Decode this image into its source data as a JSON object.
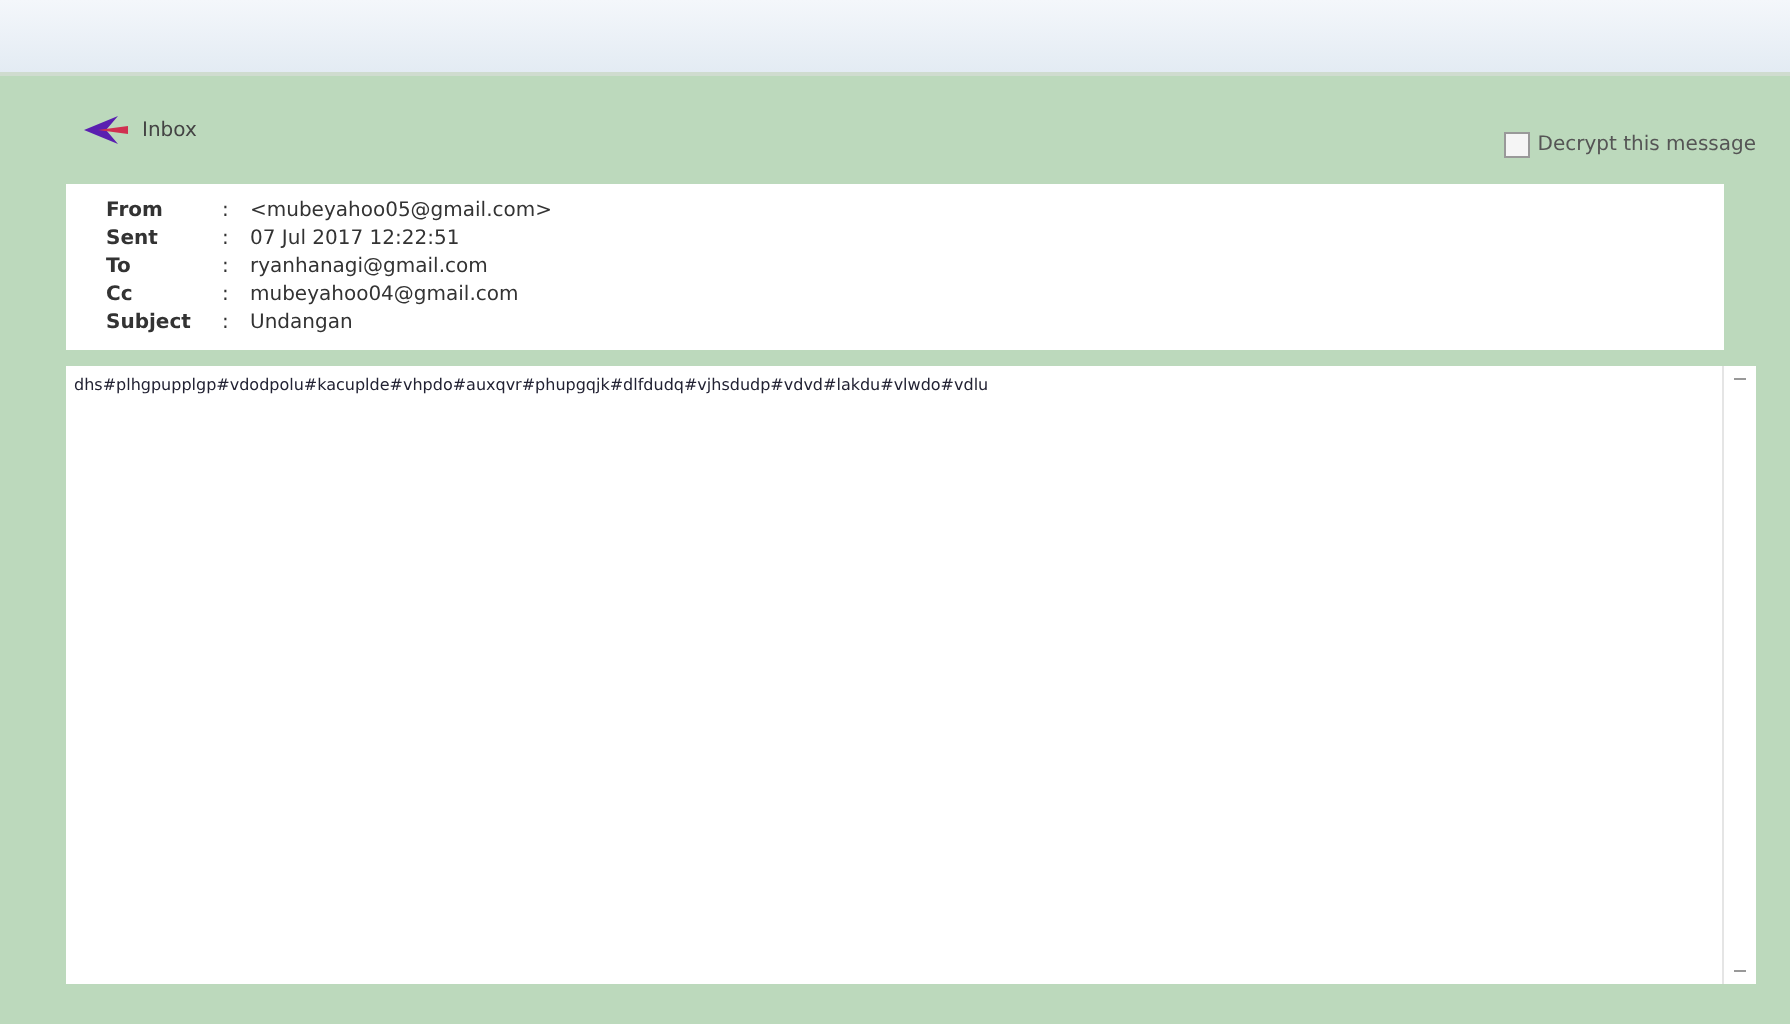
{
  "back_link": {
    "label": "Inbox"
  },
  "decrypt": {
    "label": "Decrypt this message",
    "checked": false
  },
  "headers": [
    {
      "label": "From",
      "separator": ":",
      "value": "<mubeyahoo05@gmail.com>"
    },
    {
      "label": "Sent",
      "separator": ":",
      "value": "07 Jul 2017 12:22:51"
    },
    {
      "label": "To",
      "separator": ":",
      "value": "ryanhanagi@gmail.com"
    },
    {
      "label": "Cc",
      "separator": ":",
      "value": "mubeyahoo04@gmail.com"
    },
    {
      "label": "Subject",
      "separator": ":",
      "value": "Undangan"
    }
  ],
  "body": "dhs#plhgpupplgp#vdodpolu#kacuplde#vhpdo#auxqvr#phupgqjk#dlfdudq#vjhsdudp#vdvd#lakdu#vlwdo#vdlu"
}
